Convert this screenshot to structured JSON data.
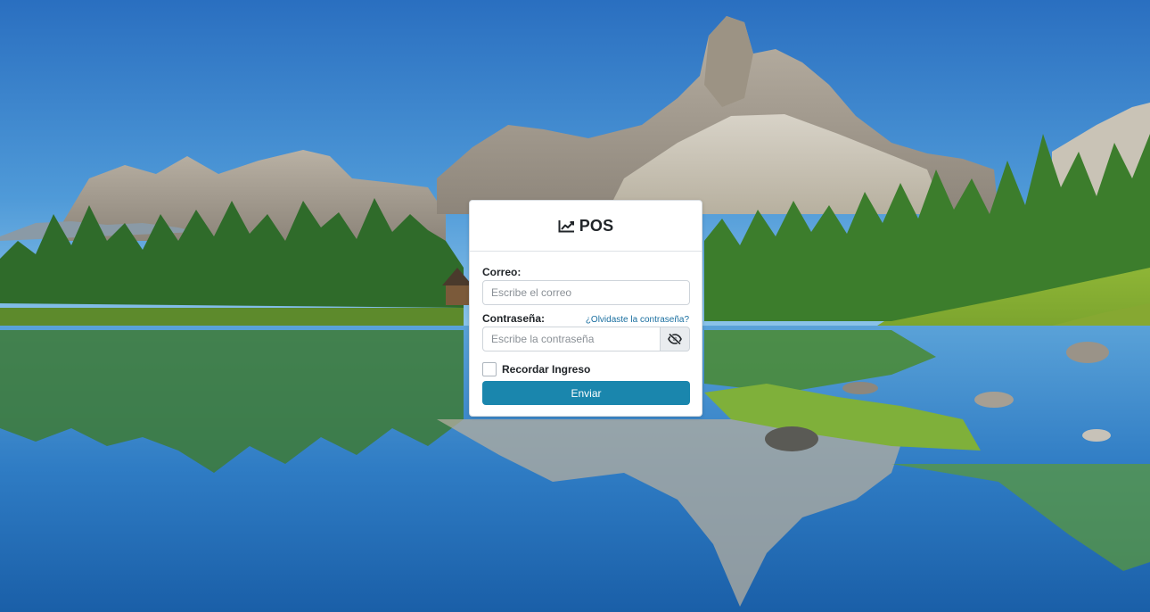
{
  "brand": {
    "title": "POS",
    "icon": "chart-line-icon"
  },
  "form": {
    "email_label": "Correo:",
    "email_placeholder": "Escribe el correo",
    "email_value": "",
    "password_label": "Contraseña:",
    "forgot_link": "¿Olvidaste la contraseña?",
    "password_placeholder": "Escribe la contraseña",
    "password_value": "",
    "toggle_icon": "eye-slash-icon",
    "remember_label": "Recordar Ingreso",
    "remember_checked": false,
    "submit_label": "Enviar"
  },
  "colors": {
    "primary": "#1a86ad",
    "link": "#1a6fa0",
    "card_bg": "#ffffff"
  }
}
